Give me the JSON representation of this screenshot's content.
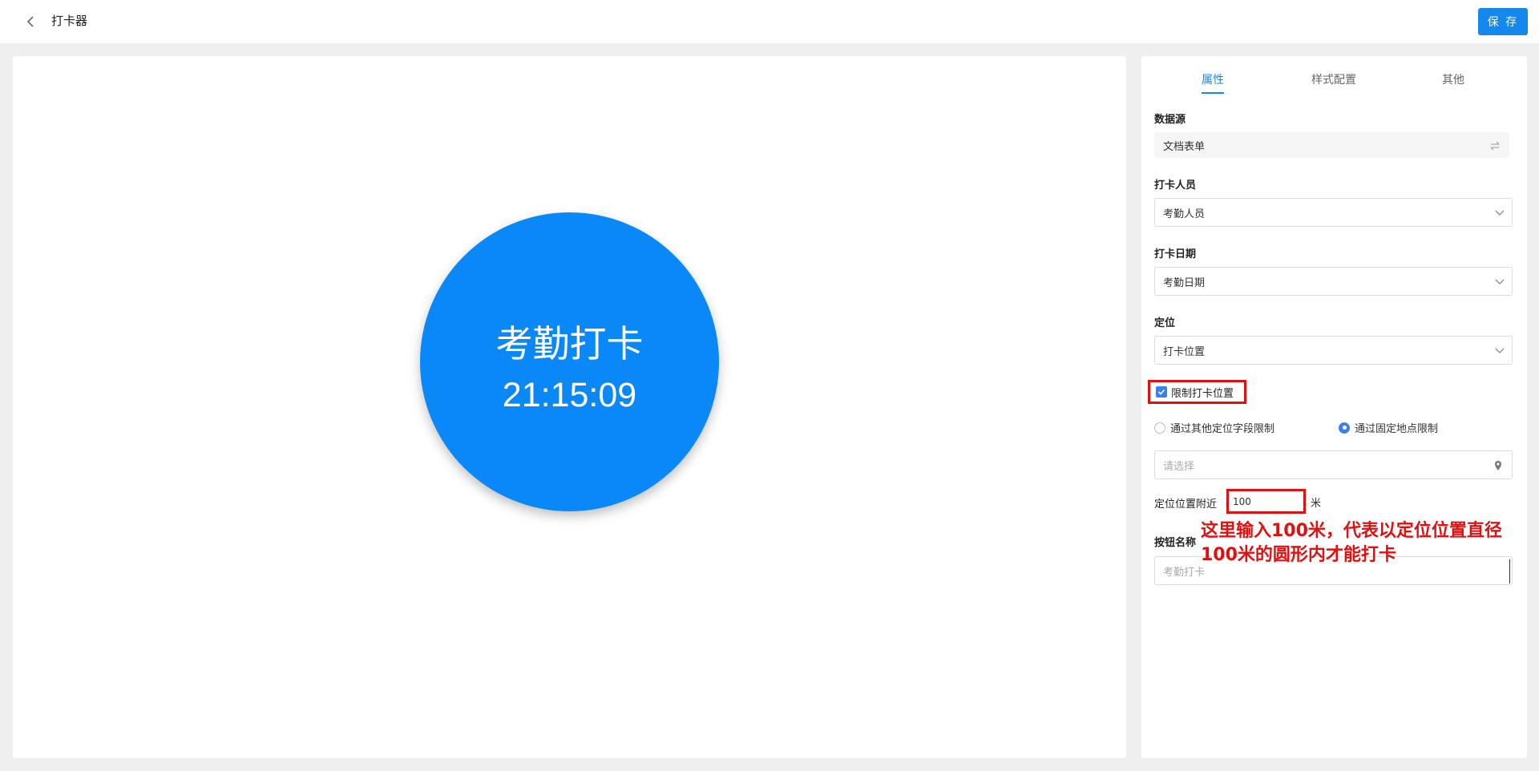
{
  "header": {
    "title": "打卡器",
    "save_label": "保 存"
  },
  "canvas": {
    "button_label": "考勤打卡",
    "time": "21:15:09",
    "button_color": "#0a88f8"
  },
  "panel": {
    "tabs": [
      {
        "label": "属性",
        "active": true
      },
      {
        "label": "样式配置",
        "active": false
      },
      {
        "label": "其他",
        "active": false
      }
    ],
    "data_source": {
      "label": "数据源",
      "value": "文档表单",
      "icon": "swap-icon"
    },
    "clock_person": {
      "label": "打卡人员",
      "value": "考勤人员"
    },
    "clock_date": {
      "label": "打卡日期",
      "value": "考勤日期"
    },
    "location": {
      "label": "定位",
      "value": "打卡位置"
    },
    "limit_location": {
      "label": "限制打卡位置",
      "checked": true
    },
    "limit_modes": [
      {
        "label": "通过其他定位字段限制",
        "selected": false
      },
      {
        "label": "通过固定地点限制",
        "selected": true
      }
    ],
    "place_select": {
      "placeholder": "请选择",
      "icon": "location-pin-icon"
    },
    "range": {
      "label": "定位位置附近",
      "value": "100",
      "unit": "米"
    },
    "annotation": "这里输入100米，代表以定位位置直径100米的圆形内才能打卡",
    "button_name": {
      "label": "按钮名称",
      "placeholder": "考勤打卡"
    }
  },
  "colors": {
    "accent": "#1588ee",
    "annotation_red": "#e01010"
  }
}
